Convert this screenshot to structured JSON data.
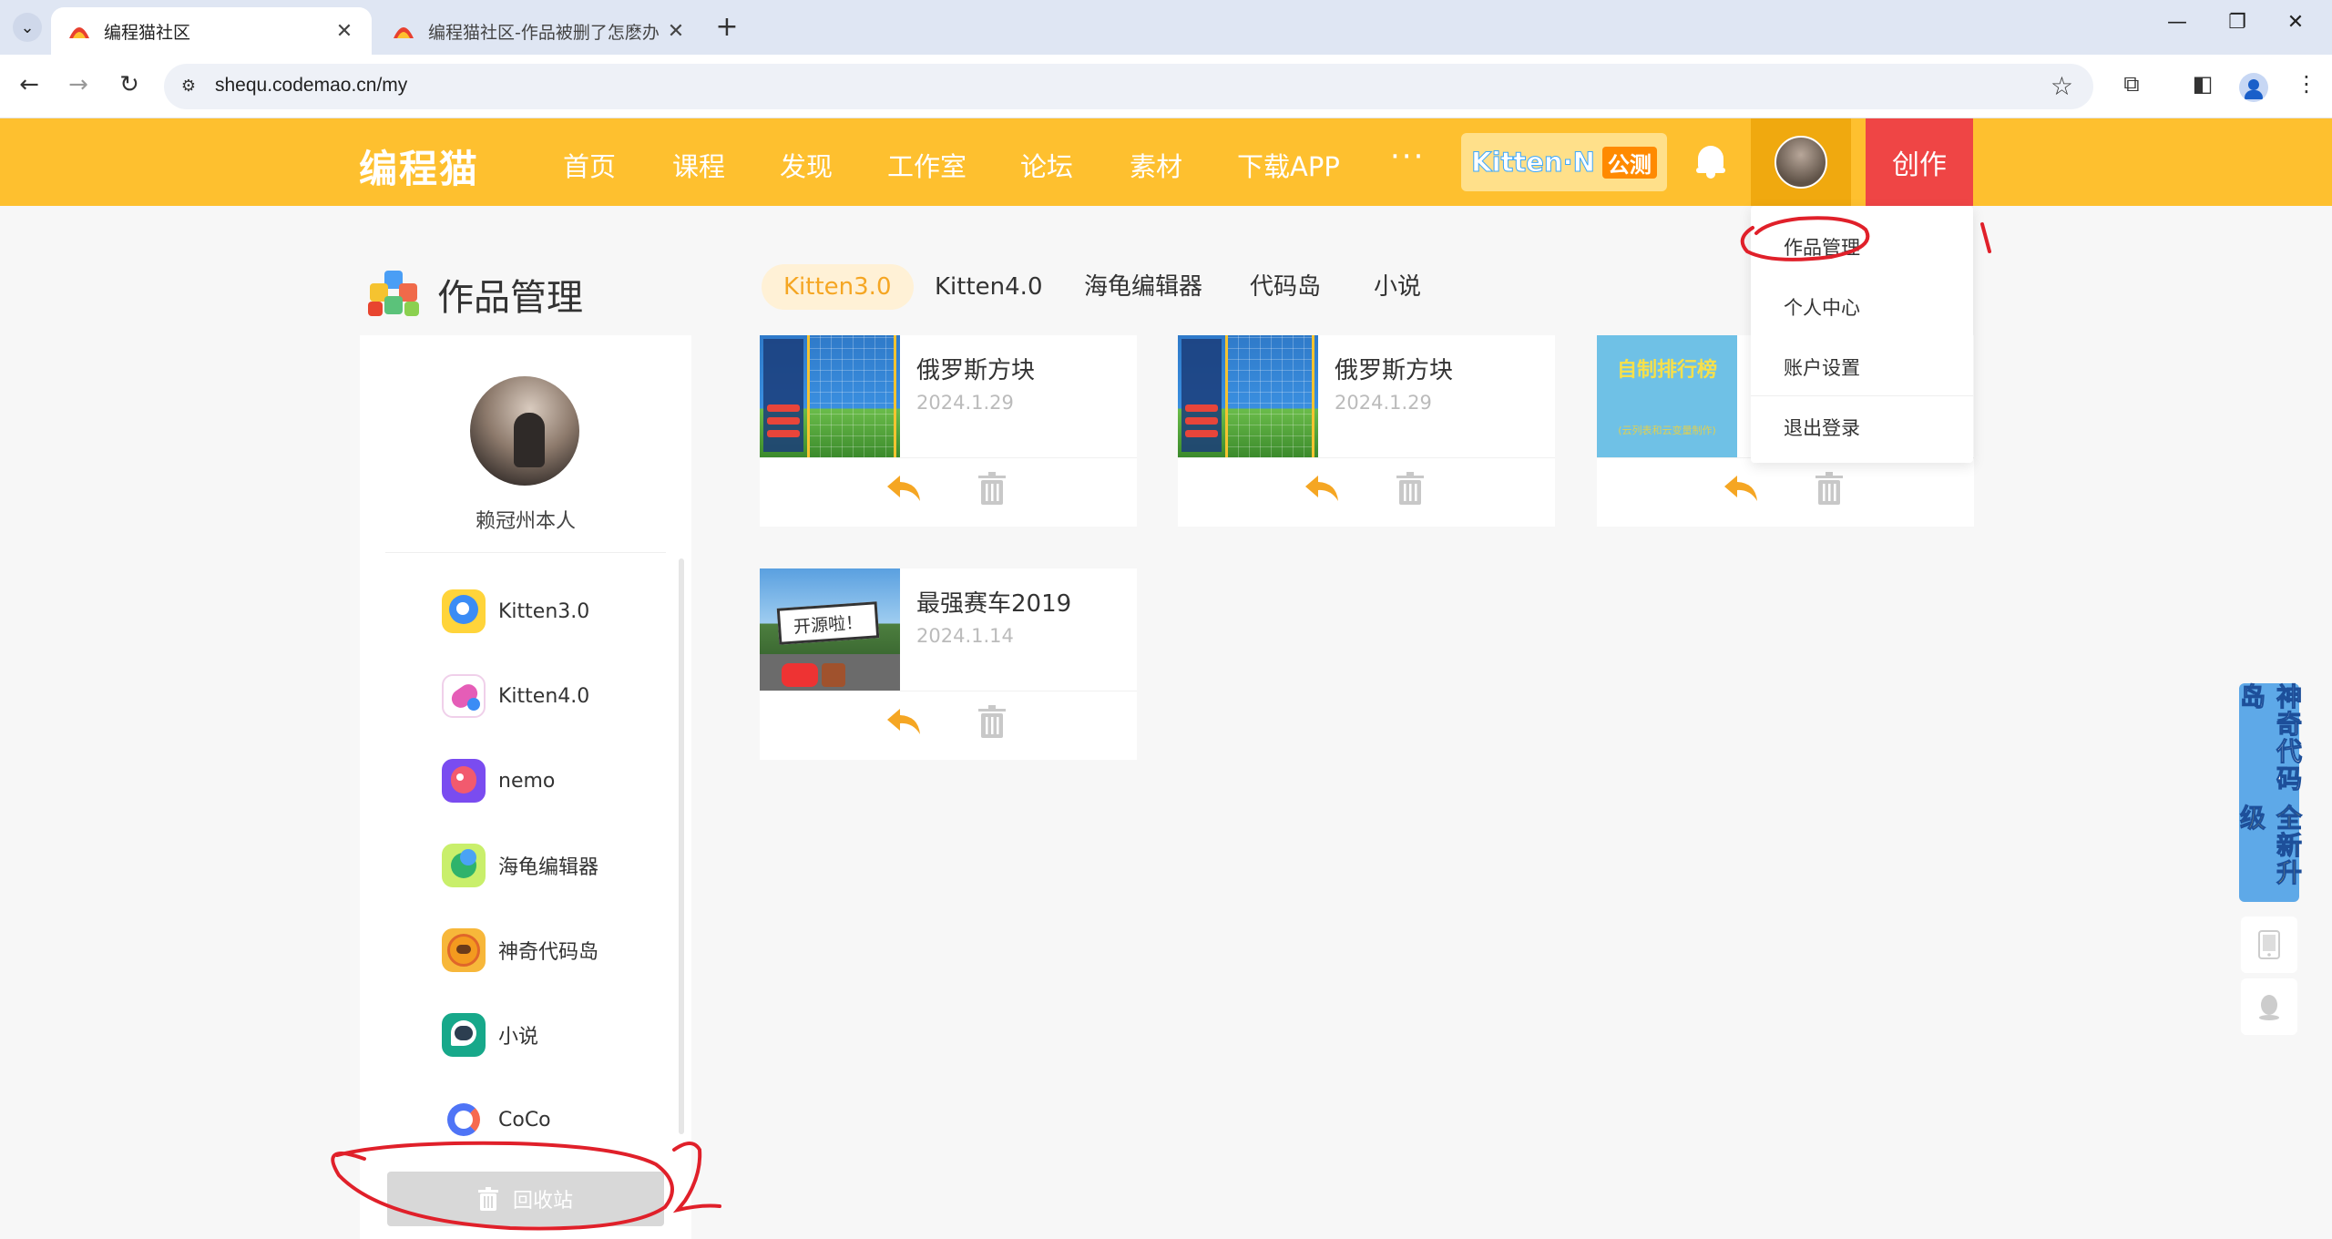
{
  "browser": {
    "tabs": [
      {
        "title": "编程猫社区",
        "active": true
      },
      {
        "title": "编程猫社区-作品被删了怎麽办",
        "active": false
      }
    ],
    "url": "shequ.codemao.cn/my"
  },
  "header": {
    "logo": "编程猫",
    "nav": [
      "首页",
      "课程",
      "发现",
      "工作室",
      "论坛",
      "素材",
      "下载APP"
    ],
    "more": "···",
    "kitten_n": {
      "brand": "Kitten·N",
      "badge": "公测"
    },
    "create_label": "创作"
  },
  "dropdown": {
    "items": [
      "作品管理",
      "个人中心",
      "账户设置",
      "退出登录"
    ]
  },
  "page": {
    "title": "作品管理",
    "type_tabs": [
      "Kitten3.0",
      "Kitten4.0",
      "海龟编辑器",
      "代码岛",
      "小说"
    ],
    "active_tab": "Kitten3.0"
  },
  "sidebar": {
    "username": "赖冠州本人",
    "items": [
      {
        "label": "Kitten3.0",
        "icon": "kitten3-app-icon",
        "color": "#3b8cf5"
      },
      {
        "label": "Kitten4.0",
        "icon": "kitten4-app-icon",
        "color": "#e55db7"
      },
      {
        "label": "nemo",
        "icon": "nemo-app-icon",
        "color": "#7a4cf0"
      },
      {
        "label": "海龟编辑器",
        "icon": "turtle-editor-app-icon",
        "color": "#2fb36b"
      },
      {
        "label": "神奇代码岛",
        "icon": "code-island-app-icon",
        "color": "#f39a1f"
      },
      {
        "label": "小说",
        "icon": "novel-app-icon",
        "color": "#17a88a"
      },
      {
        "label": "CoCo",
        "icon": "coco-app-icon",
        "color": "#4f74f6"
      }
    ],
    "recycle_label": "回收站"
  },
  "works": [
    {
      "name": "俄罗斯方块",
      "date": "2024.1.29",
      "thumb": "tetris"
    },
    {
      "name": "俄罗斯方块",
      "date": "2024.1.29",
      "thumb": "tetris"
    },
    {
      "name": "",
      "date": "",
      "thumb": "leaderboard",
      "thumb_title": "自制排行榜",
      "thumb_sub": "(云列表和云变量制作)"
    },
    {
      "name": "最强赛车2019",
      "date": "2024.1.14",
      "thumb": "racing",
      "thumb_text": "开源啦！"
    }
  ],
  "float_banner": {
    "line1": "神奇代码岛",
    "line2": "全新升级"
  },
  "colors": {
    "header_yellow": "#fec02f",
    "create_red": "#ef4545",
    "accent_orange": "#f5a623",
    "annotation_red": "#e0202a"
  }
}
